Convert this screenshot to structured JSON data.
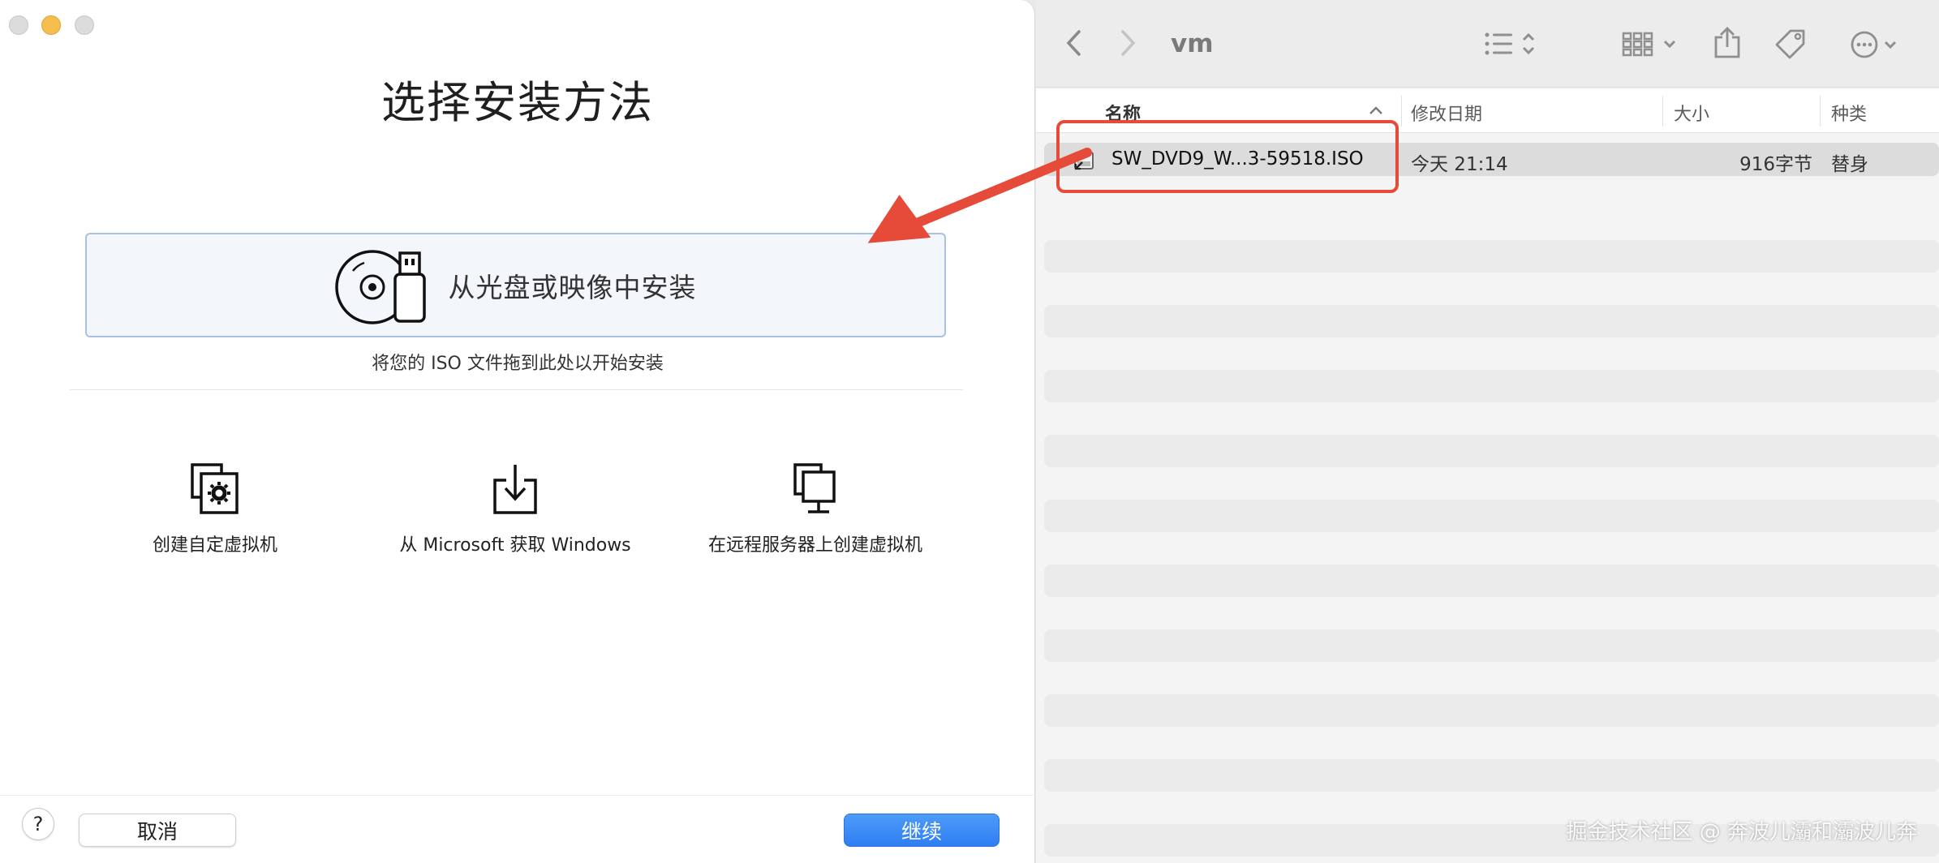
{
  "dialog": {
    "title": "选择安装方法",
    "drop_zone": {
      "label": "从光盘或映像中安装",
      "hint": "将您的 ISO 文件拖到此处以开始安装"
    },
    "options": [
      {
        "label": "创建自定虚拟机",
        "icon": "custom-vm-icon"
      },
      {
        "label": "从 Microsoft 获取 Windows",
        "icon": "download-icon"
      },
      {
        "label": "在远程服务器上创建虚拟机",
        "icon": "remote-server-icon"
      }
    ],
    "help_label": "?",
    "cancel_label": "取消",
    "continue_label": "继续",
    "accent_color": "#2f7ef3"
  },
  "finder": {
    "folder_title": "vm",
    "columns": {
      "name": "名称",
      "date": "修改日期",
      "size": "大小",
      "kind": "种类"
    },
    "file": {
      "name": "SW_DVD9_W...3-59518.ISO",
      "date": "今天 21:14",
      "size": "916字节",
      "kind": "替身"
    }
  },
  "annotation": {
    "color": "#e64a38"
  },
  "watermark": "掘金技术社区 @ 奔波儿灞和灞波儿奔"
}
